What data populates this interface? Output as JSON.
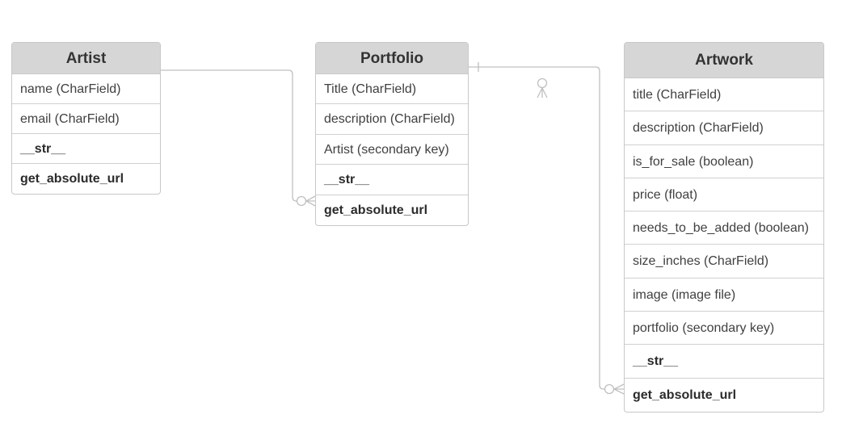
{
  "diagram": {
    "entities": [
      {
        "id": "artist",
        "title": "Artist",
        "fields": [
          "name (CharField)",
          "email (CharField)"
        ],
        "methods": [
          "__str__",
          "get_absolute_url"
        ]
      },
      {
        "id": "portfolio",
        "title": "Portfolio",
        "fields": [
          "Title (CharField)",
          "description (CharField)",
          "Artist (secondary key)"
        ],
        "methods": [
          "__str__",
          "get_absolute_url"
        ]
      },
      {
        "id": "artwork",
        "title": "Artwork",
        "fields": [
          "title (CharField)",
          "description (CharField)",
          "is_for_sale (boolean)",
          "price (float)",
          "needs_to_be_added (boolean)",
          "size_inches (CharField)",
          "image (image file)",
          "portfolio (secondary key)"
        ],
        "methods": [
          "__str__",
          "get_absolute_url"
        ]
      }
    ],
    "relationships": [
      {
        "from": "artist",
        "to": "portfolio",
        "from_end": "none",
        "to_end": "zero-or-many"
      },
      {
        "from": "portfolio",
        "to": "artwork",
        "from_end": "one",
        "to_end": "zero-or-many"
      }
    ],
    "colors": {
      "header_background": "#d6d6d6",
      "border": "#c8c8c8",
      "connector": "#c0c0c0",
      "text": "#333333"
    }
  }
}
